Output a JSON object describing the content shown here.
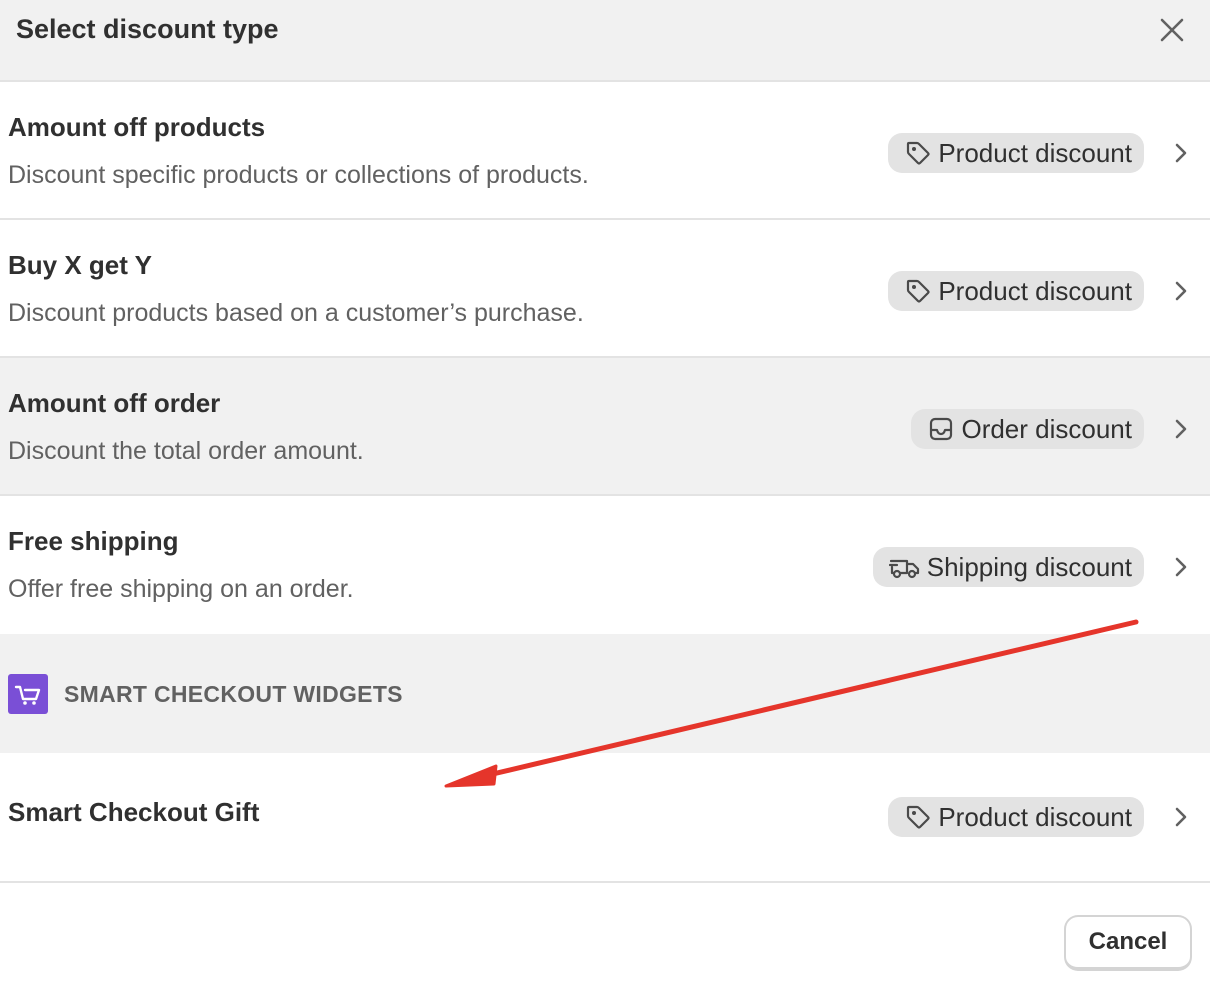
{
  "modal": {
    "title": "Select discount type",
    "close_icon": "close-icon"
  },
  "discount_types": [
    {
      "title": "Amount off products",
      "description": "Discount specific products or collections of products.",
      "badge": "Product discount",
      "badge_icon": "tag-icon"
    },
    {
      "title": "Buy X get Y",
      "description": "Discount products based on a customer’s purchase.",
      "badge": "Product discount",
      "badge_icon": "tag-icon"
    },
    {
      "title": "Amount off order",
      "description": "Discount the total order amount.",
      "badge": "Order discount",
      "badge_icon": "inbox-icon"
    },
    {
      "title": "Free shipping",
      "description": "Offer free shipping on an order.",
      "badge": "Shipping discount",
      "badge_icon": "truck-icon"
    }
  ],
  "app_section": {
    "label": "SMART CHECKOUT WIDGETS",
    "logo_color": "#7a4fd6",
    "items": [
      {
        "title": "Smart Checkout Gift",
        "badge": "Product discount",
        "badge_icon": "tag-icon"
      }
    ]
  },
  "footer": {
    "cancel_label": "Cancel"
  },
  "colors": {
    "header_bg": "#f1f1f1",
    "badge_bg": "#e3e3e3",
    "annotation_arrow": "#e5352b"
  }
}
